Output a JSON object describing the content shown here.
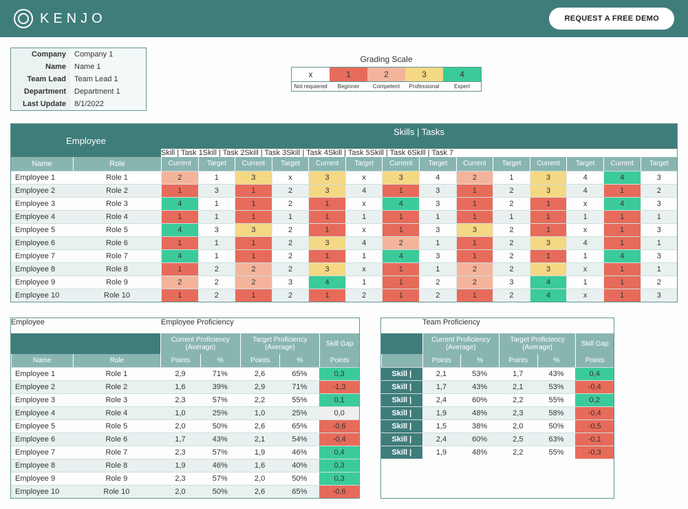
{
  "header": {
    "brand": "KENJO",
    "cta": "REQUEST A FREE DEMO"
  },
  "meta": {
    "labels": {
      "company": "Company",
      "name": "Name",
      "team_lead": "Team Lead",
      "department": "Department",
      "last_update": "Last Update"
    },
    "values": {
      "company": "Company 1",
      "name": "Name 1",
      "team_lead": "Team Lead 1",
      "department": "Department 1",
      "last_update": "8/1/2022"
    }
  },
  "grading": {
    "title": "Grading Scale",
    "cells": [
      {
        "num": "x",
        "label": "Not requiered",
        "bg": "#ffffff"
      },
      {
        "num": "1",
        "label": "Beginner",
        "bg": "#e76b5b"
      },
      {
        "num": "2",
        "label": "Competent",
        "bg": "#f4b49c"
      },
      {
        "num": "3",
        "label": "Professional",
        "bg": "#f5d884"
      },
      {
        "num": "4",
        "label": "Expert",
        "bg": "#3bcb9a"
      }
    ]
  },
  "skills": {
    "emp_header": "Employee",
    "tasks_header": "Skills | Tasks",
    "columns": [
      "Skill | Task 1",
      "Skill | Task 2",
      "Skill | Task 3",
      "Skill | Task 4",
      "Skill | Task 5",
      "Skill | Task 6",
      "Skill | Task 7"
    ],
    "sub": [
      "Current",
      "Target"
    ],
    "name_h": "Name",
    "role_h": "Role",
    "rows": [
      {
        "name": "Employee 1",
        "role": "Role 1",
        "v": [
          "2",
          "1",
          "3",
          "x",
          "3",
          "x",
          "3",
          "4",
          "2",
          "1",
          "3",
          "4",
          "4",
          "3"
        ]
      },
      {
        "name": "Employee 2",
        "role": "Role 2",
        "v": [
          "1",
          "3",
          "1",
          "2",
          "3",
          "4",
          "1",
          "3",
          "1",
          "2",
          "3",
          "4",
          "1",
          "2"
        ]
      },
      {
        "name": "Employee 3",
        "role": "Role 3",
        "v": [
          "4",
          "1",
          "1",
          "2",
          "1",
          "x",
          "4",
          "3",
          "1",
          "2",
          "1",
          "x",
          "4",
          "3"
        ]
      },
      {
        "name": "Employee 4",
        "role": "Role 4",
        "v": [
          "1",
          "1",
          "1",
          "1",
          "1",
          "1",
          "1",
          "1",
          "1",
          "1",
          "1",
          "1",
          "1",
          "1"
        ]
      },
      {
        "name": "Employee 5",
        "role": "Role 5",
        "v": [
          "4",
          "3",
          "3",
          "2",
          "1",
          "x",
          "1",
          "3",
          "3",
          "2",
          "1",
          "x",
          "1",
          "3"
        ]
      },
      {
        "name": "Employee 6",
        "role": "Role 6",
        "v": [
          "1",
          "1",
          "1",
          "2",
          "3",
          "4",
          "2",
          "1",
          "1",
          "2",
          "3",
          "4",
          "1",
          "1"
        ]
      },
      {
        "name": "Employee 7",
        "role": "Role 7",
        "v": [
          "4",
          "1",
          "1",
          "2",
          "1",
          "1",
          "4",
          "3",
          "1",
          "2",
          "1",
          "1",
          "4",
          "3"
        ]
      },
      {
        "name": "Employee 8",
        "role": "Role 8",
        "v": [
          "1",
          "2",
          "2",
          "2",
          "3",
          "x",
          "1",
          "1",
          "2",
          "2",
          "3",
          "x",
          "1",
          "1"
        ]
      },
      {
        "name": "Employee 9",
        "role": "Role 9",
        "v": [
          "2",
          "2",
          "2",
          "3",
          "4",
          "1",
          "1",
          "2",
          "2",
          "3",
          "4",
          "1",
          "1",
          "2"
        ]
      },
      {
        "name": "Employee 10",
        "role": "Role 10",
        "v": [
          "1",
          "2",
          "1",
          "2",
          "1",
          "2",
          "1",
          "2",
          "1",
          "2",
          "4",
          "x",
          "1",
          "3"
        ]
      }
    ]
  },
  "emp_prof": {
    "emp_header": "Employee",
    "title": "Employee Proficiency",
    "groups": [
      "Current  Proficiency (Average)",
      "Target Proficiency (Average)",
      "Skill Gap"
    ],
    "cols": [
      "Name",
      "Role",
      "Points",
      "%",
      "Points",
      "%",
      "Points"
    ],
    "widths": [
      90,
      128,
      58,
      58,
      58,
      58,
      58
    ],
    "rows": [
      {
        "name": "Employee 1",
        "role": "Role 1",
        "cp": "2,9",
        "cpct": "71%",
        "tp": "2,6",
        "tpct": "65%",
        "gap": "0,3"
      },
      {
        "name": "Employee 2",
        "role": "Role 2",
        "cp": "1,6",
        "cpct": "39%",
        "tp": "2,9",
        "tpct": "71%",
        "gap": "-1,3"
      },
      {
        "name": "Employee 3",
        "role": "Role 3",
        "cp": "2,3",
        "cpct": "57%",
        "tp": "2,2",
        "tpct": "55%",
        "gap": "0,1"
      },
      {
        "name": "Employee 4",
        "role": "Role 4",
        "cp": "1,0",
        "cpct": "25%",
        "tp": "1,0",
        "tpct": "25%",
        "gap": "0,0"
      },
      {
        "name": "Employee 5",
        "role": "Role 5",
        "cp": "2,0",
        "cpct": "50%",
        "tp": "2,6",
        "tpct": "65%",
        "gap": "-0,6"
      },
      {
        "name": "Employee 6",
        "role": "Role 6",
        "cp": "1,7",
        "cpct": "43%",
        "tp": "2,1",
        "tpct": "54%",
        "gap": "-0,4"
      },
      {
        "name": "Employee 7",
        "role": "Role 7",
        "cp": "2,3",
        "cpct": "57%",
        "tp": "1,9",
        "tpct": "46%",
        "gap": "0,4"
      },
      {
        "name": "Employee 8",
        "role": "Role 8",
        "cp": "1,9",
        "cpct": "46%",
        "tp": "1,6",
        "tpct": "40%",
        "gap": "0,3"
      },
      {
        "name": "Employee 9",
        "role": "Role 9",
        "cp": "2,3",
        "cpct": "57%",
        "tp": "2,0",
        "tpct": "50%",
        "gap": "0,3"
      },
      {
        "name": "Employee 10",
        "role": "Role 10",
        "cp": "2,0",
        "cpct": "50%",
        "tp": "2,6",
        "tpct": "65%",
        "gap": "-0,6"
      }
    ]
  },
  "team_prof": {
    "title": "Team Proficiency",
    "groups": [
      "Current  Proficiency (Average)",
      "Target Proficiency (Average)",
      "Skill Gap"
    ],
    "cols": [
      "",
      "Points",
      "%",
      "Points",
      "%",
      "Points"
    ],
    "widths": [
      60,
      56,
      56,
      56,
      56,
      56
    ],
    "rows": [
      {
        "label": "Skill |",
        "cp": "2,1",
        "cpct": "53%",
        "tp": "1,7",
        "tpct": "43%",
        "gap": "0,4"
      },
      {
        "label": "Skill |",
        "cp": "1,7",
        "cpct": "43%",
        "tp": "2,1",
        "tpct": "53%",
        "gap": "-0,4"
      },
      {
        "label": "Skill |",
        "cp": "2,4",
        "cpct": "60%",
        "tp": "2,2",
        "tpct": "55%",
        "gap": "0,2"
      },
      {
        "label": "Skill |",
        "cp": "1,9",
        "cpct": "48%",
        "tp": "2,3",
        "tpct": "58%",
        "gap": "-0,4"
      },
      {
        "label": "Skill |",
        "cp": "1,5",
        "cpct": "38%",
        "tp": "2,0",
        "tpct": "50%",
        "gap": "-0,5"
      },
      {
        "label": "Skill |",
        "cp": "2,4",
        "cpct": "60%",
        "tp": "2,5",
        "tpct": "63%",
        "gap": "-0,1"
      },
      {
        "label": "Skill |",
        "cp": "1,9",
        "cpct": "48%",
        "tp": "2,2",
        "tpct": "55%",
        "gap": "-0,3"
      }
    ]
  }
}
